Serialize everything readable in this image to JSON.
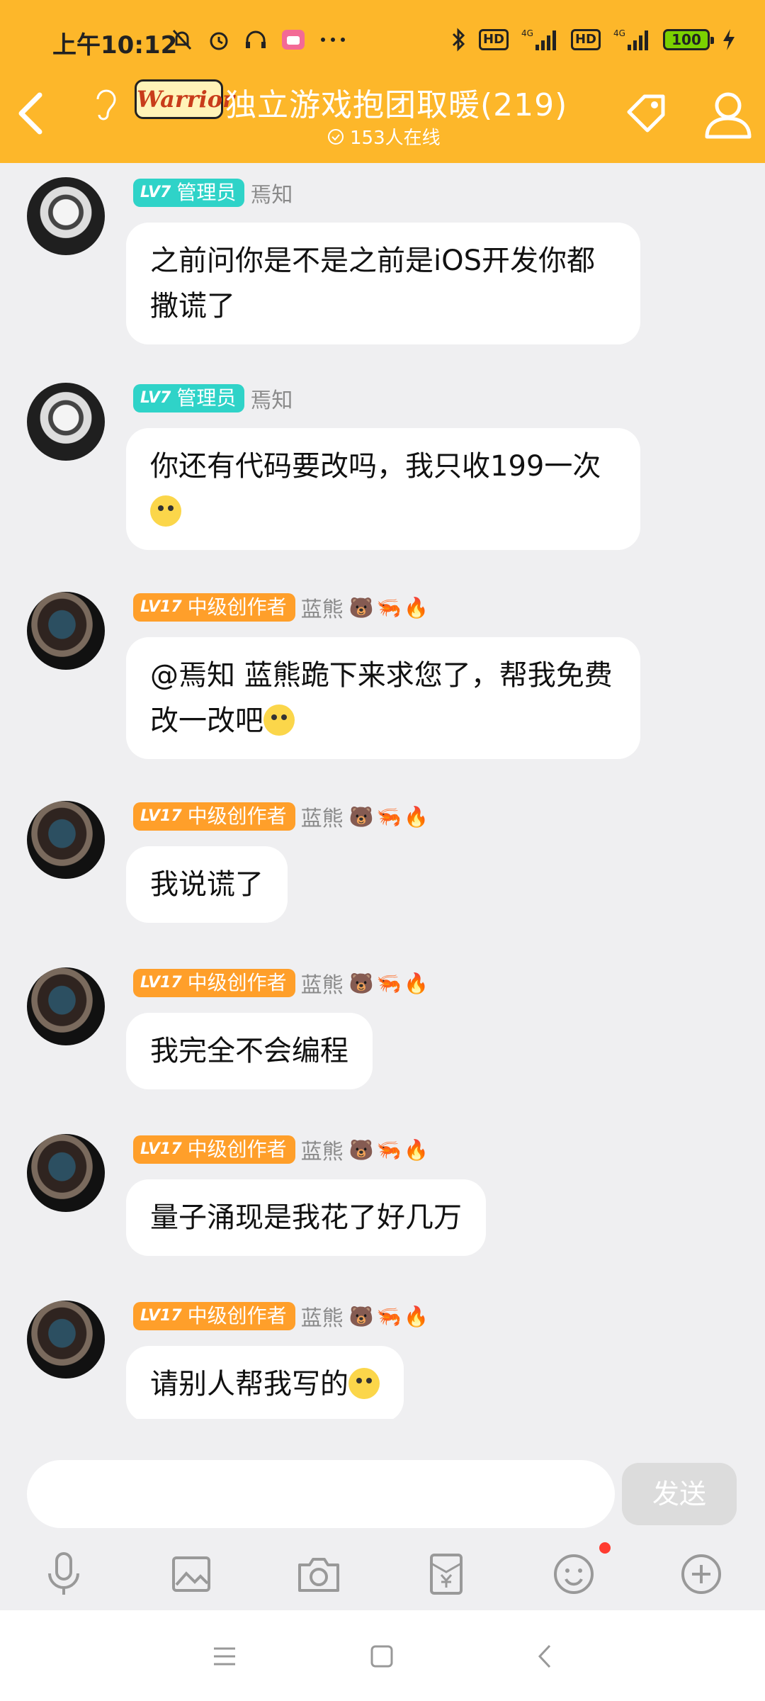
{
  "status": {
    "time": "上午10:12",
    "hd1": "HD",
    "net1": "4G",
    "hd2": "HD",
    "net2": "4G",
    "battery": "100"
  },
  "header": {
    "logo_text": "Warrior",
    "title": "独立游戏抱团取暖(219)",
    "online": "153人在线"
  },
  "messages": [
    {
      "badge_lv": "LV7",
      "badge_role": "管理员",
      "nick": "焉知",
      "text": "之前问你是不是之前是iOS开发你都撒谎了"
    },
    {
      "badge_lv": "LV7",
      "badge_role": "管理员",
      "nick": "焉知",
      "text": "你还有代码要改吗，我只收199一次"
    },
    {
      "badge_lv": "LV17",
      "badge_role": "中级创作者",
      "nick": "蓝熊",
      "deco": "🐻🦐🔥",
      "text": "@焉知 蓝熊跪下来求您了，帮我免费改一改吧"
    },
    {
      "badge_lv": "LV17",
      "badge_role": "中级创作者",
      "nick": "蓝熊",
      "deco": "🐻🦐🔥",
      "text": "我说谎了"
    },
    {
      "badge_lv": "LV17",
      "badge_role": "中级创作者",
      "nick": "蓝熊",
      "deco": "🐻🦐🔥",
      "text": "我完全不会编程"
    },
    {
      "badge_lv": "LV17",
      "badge_role": "中级创作者",
      "nick": "蓝熊",
      "deco": "🐻🦐🔥",
      "text": "量子涌现是我花了好几万"
    },
    {
      "badge_lv": "LV17",
      "badge_role": "中级创作者",
      "nick": "蓝熊",
      "deco": "🐻🦐🔥",
      "text": "请别人帮我写的"
    }
  ],
  "input": {
    "send_label": "发送"
  }
}
